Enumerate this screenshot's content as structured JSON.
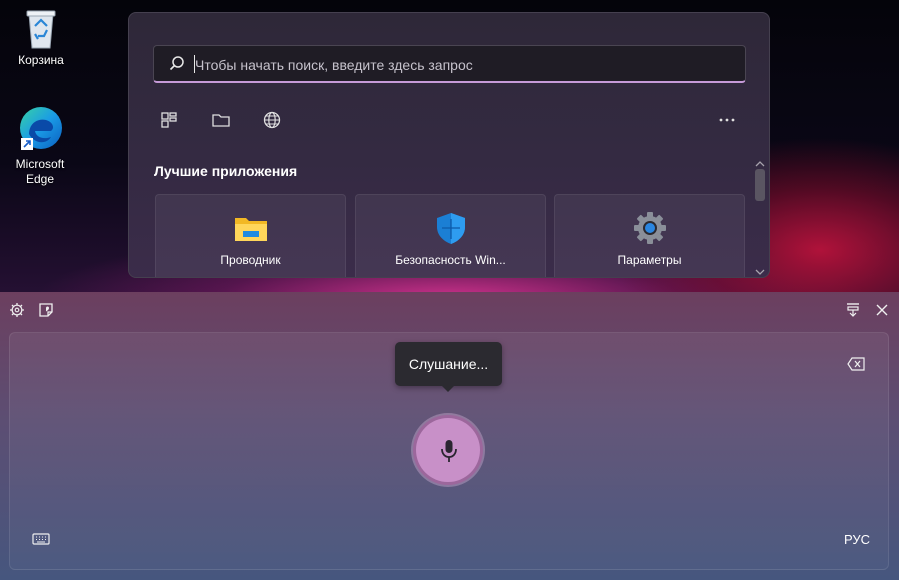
{
  "desktop": {
    "icons": [
      {
        "label": "Корзина",
        "icon": "recycle-bin-icon"
      },
      {
        "label": "Microsoft\nEdge",
        "label_line1": "Microsoft",
        "label_line2": "Edge",
        "icon": "edge-icon"
      }
    ]
  },
  "start_menu": {
    "search_placeholder": "Чтобы начать поиск, введите здесь запрос",
    "quick_icons": [
      "apps-icon",
      "folder-icon",
      "globe-icon",
      "more-icon"
    ],
    "section_title": "Лучшие приложения",
    "apps": [
      {
        "label": "Проводник",
        "icon": "file-explorer-icon"
      },
      {
        "label": "Безопасность Win...",
        "icon": "windows-security-icon"
      },
      {
        "label": "Параметры",
        "icon": "settings-gear-icon"
      }
    ]
  },
  "voice_typing": {
    "toolbar_icons": [
      "settings-icon",
      "sticker-icon",
      "dock-icon",
      "close-icon"
    ],
    "tooltip": "Слушание...",
    "mic_color": "#c890c8",
    "language": "РУС"
  }
}
